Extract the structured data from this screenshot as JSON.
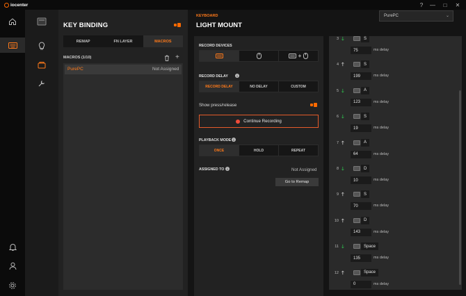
{
  "app": {
    "title": "iocenter"
  },
  "window": {
    "help": "?",
    "min": "—",
    "max": "□",
    "close": "✕"
  },
  "nav": {
    "items": [
      "home-icon",
      "keyboard-icon",
      "bell-icon",
      "user-icon",
      "settings-icon"
    ],
    "active": "keyboard-icon"
  },
  "subnav": {
    "items": [
      "display-icon",
      "lighting-icon",
      "keybinding-icon",
      "tools-icon"
    ]
  },
  "keybinding": {
    "title": "KEY BINDING",
    "tabs": [
      "REMAP",
      "FN LAYER",
      "MACROS"
    ],
    "active_tab": "MACROS",
    "macros_label": "MACROS (1/10)",
    "macros": [
      {
        "name": "PurePC",
        "assigned": "Not Assigned"
      }
    ]
  },
  "device": {
    "type": "KEYBOARD",
    "name": "LIGHT MOUNT"
  },
  "profile": {
    "value": "PurePC",
    "chevron": "⌄"
  },
  "settings": {
    "record_devices_label": "RECORD DEVICES",
    "record_delay_label": "RECORD DELAY",
    "delay_options": [
      "RECORD DELAY",
      "NO DELAY",
      "CUSTOM"
    ],
    "show_press_label": "Show press/release",
    "record_button": "Continue Recording",
    "playback_label": "PLAYBACK MODE",
    "playback_options": [
      "ONCE",
      "HOLD",
      "REPEAT"
    ],
    "assigned_label": "ASSIGNED TO",
    "assigned_value": "Not Assigned",
    "remap_button": "Go to Remap",
    "info": "i",
    "plus": "+"
  },
  "steps": [
    {
      "n": "3",
      "dir": "down",
      "arrow": "🡓",
      "key": "S",
      "delay": "75",
      "unit": "ms delay"
    },
    {
      "n": "4",
      "dir": "up",
      "arrow": "🡑",
      "key": "S",
      "delay": "199",
      "unit": "ms delay"
    },
    {
      "n": "5",
      "dir": "down",
      "arrow": "🡓",
      "key": "A",
      "delay": "123",
      "unit": "ms delay"
    },
    {
      "n": "6",
      "dir": "down",
      "arrow": "🡓",
      "key": "S",
      "delay": "19",
      "unit": "ms delay"
    },
    {
      "n": "7",
      "dir": "up",
      "arrow": "🡑",
      "key": "A",
      "delay": "64",
      "unit": "ms delay"
    },
    {
      "n": "8",
      "dir": "down",
      "arrow": "🡓",
      "key": "D",
      "delay": "10",
      "unit": "ms delay"
    },
    {
      "n": "9",
      "dir": "up",
      "arrow": "🡑",
      "key": "S",
      "delay": "70",
      "unit": "ms delay"
    },
    {
      "n": "10",
      "dir": "up",
      "arrow": "🡑",
      "key": "D",
      "delay": "143",
      "unit": "ms delay"
    },
    {
      "n": "11",
      "dir": "down",
      "arrow": "🡓",
      "key": "Space",
      "delay": "135",
      "unit": "ms delay"
    },
    {
      "n": "12",
      "dir": "up",
      "arrow": "🡑",
      "key": "Space",
      "delay": "0",
      "unit": "ms delay"
    }
  ],
  "colors": {
    "accent": "#ff7a1a",
    "down": "#2fb84c",
    "record": "#ef4b3a"
  }
}
